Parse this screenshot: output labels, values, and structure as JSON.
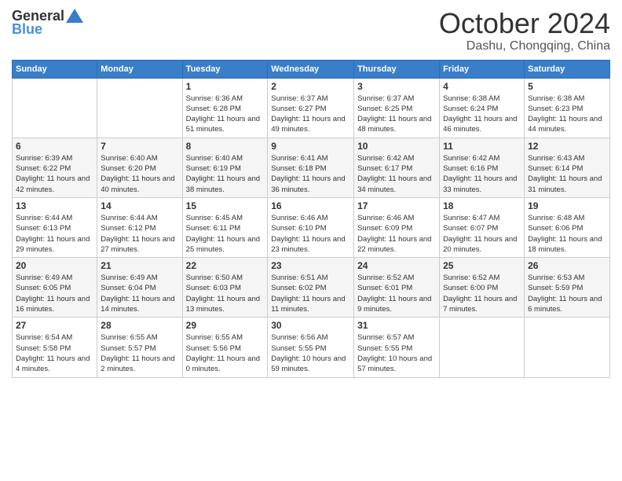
{
  "logo": {
    "general": "General",
    "blue": "Blue"
  },
  "title": "October 2024",
  "location": "Dashu, Chongqing, China",
  "headers": [
    "Sunday",
    "Monday",
    "Tuesday",
    "Wednesday",
    "Thursday",
    "Friday",
    "Saturday"
  ],
  "weeks": [
    [
      {
        "day": "",
        "sunrise": "",
        "sunset": "",
        "daylight": ""
      },
      {
        "day": "",
        "sunrise": "",
        "sunset": "",
        "daylight": ""
      },
      {
        "day": "1",
        "sunrise": "Sunrise: 6:36 AM",
        "sunset": "Sunset: 6:28 PM",
        "daylight": "Daylight: 11 hours and 51 minutes."
      },
      {
        "day": "2",
        "sunrise": "Sunrise: 6:37 AM",
        "sunset": "Sunset: 6:27 PM",
        "daylight": "Daylight: 11 hours and 49 minutes."
      },
      {
        "day": "3",
        "sunrise": "Sunrise: 6:37 AM",
        "sunset": "Sunset: 6:25 PM",
        "daylight": "Daylight: 11 hours and 48 minutes."
      },
      {
        "day": "4",
        "sunrise": "Sunrise: 6:38 AM",
        "sunset": "Sunset: 6:24 PM",
        "daylight": "Daylight: 11 hours and 46 minutes."
      },
      {
        "day": "5",
        "sunrise": "Sunrise: 6:38 AM",
        "sunset": "Sunset: 6:23 PM",
        "daylight": "Daylight: 11 hours and 44 minutes."
      }
    ],
    [
      {
        "day": "6",
        "sunrise": "Sunrise: 6:39 AM",
        "sunset": "Sunset: 6:22 PM",
        "daylight": "Daylight: 11 hours and 42 minutes."
      },
      {
        "day": "7",
        "sunrise": "Sunrise: 6:40 AM",
        "sunset": "Sunset: 6:20 PM",
        "daylight": "Daylight: 11 hours and 40 minutes."
      },
      {
        "day": "8",
        "sunrise": "Sunrise: 6:40 AM",
        "sunset": "Sunset: 6:19 PM",
        "daylight": "Daylight: 11 hours and 38 minutes."
      },
      {
        "day": "9",
        "sunrise": "Sunrise: 6:41 AM",
        "sunset": "Sunset: 6:18 PM",
        "daylight": "Daylight: 11 hours and 36 minutes."
      },
      {
        "day": "10",
        "sunrise": "Sunrise: 6:42 AM",
        "sunset": "Sunset: 6:17 PM",
        "daylight": "Daylight: 11 hours and 34 minutes."
      },
      {
        "day": "11",
        "sunrise": "Sunrise: 6:42 AM",
        "sunset": "Sunset: 6:16 PM",
        "daylight": "Daylight: 11 hours and 33 minutes."
      },
      {
        "day": "12",
        "sunrise": "Sunrise: 6:43 AM",
        "sunset": "Sunset: 6:14 PM",
        "daylight": "Daylight: 11 hours and 31 minutes."
      }
    ],
    [
      {
        "day": "13",
        "sunrise": "Sunrise: 6:44 AM",
        "sunset": "Sunset: 6:13 PM",
        "daylight": "Daylight: 11 hours and 29 minutes."
      },
      {
        "day": "14",
        "sunrise": "Sunrise: 6:44 AM",
        "sunset": "Sunset: 6:12 PM",
        "daylight": "Daylight: 11 hours and 27 minutes."
      },
      {
        "day": "15",
        "sunrise": "Sunrise: 6:45 AM",
        "sunset": "Sunset: 6:11 PM",
        "daylight": "Daylight: 11 hours and 25 minutes."
      },
      {
        "day": "16",
        "sunrise": "Sunrise: 6:46 AM",
        "sunset": "Sunset: 6:10 PM",
        "daylight": "Daylight: 11 hours and 23 minutes."
      },
      {
        "day": "17",
        "sunrise": "Sunrise: 6:46 AM",
        "sunset": "Sunset: 6:09 PM",
        "daylight": "Daylight: 11 hours and 22 minutes."
      },
      {
        "day": "18",
        "sunrise": "Sunrise: 6:47 AM",
        "sunset": "Sunset: 6:07 PM",
        "daylight": "Daylight: 11 hours and 20 minutes."
      },
      {
        "day": "19",
        "sunrise": "Sunrise: 6:48 AM",
        "sunset": "Sunset: 6:06 PM",
        "daylight": "Daylight: 11 hours and 18 minutes."
      }
    ],
    [
      {
        "day": "20",
        "sunrise": "Sunrise: 6:49 AM",
        "sunset": "Sunset: 6:05 PM",
        "daylight": "Daylight: 11 hours and 16 minutes."
      },
      {
        "day": "21",
        "sunrise": "Sunrise: 6:49 AM",
        "sunset": "Sunset: 6:04 PM",
        "daylight": "Daylight: 11 hours and 14 minutes."
      },
      {
        "day": "22",
        "sunrise": "Sunrise: 6:50 AM",
        "sunset": "Sunset: 6:03 PM",
        "daylight": "Daylight: 11 hours and 13 minutes."
      },
      {
        "day": "23",
        "sunrise": "Sunrise: 6:51 AM",
        "sunset": "Sunset: 6:02 PM",
        "daylight": "Daylight: 11 hours and 11 minutes."
      },
      {
        "day": "24",
        "sunrise": "Sunrise: 6:52 AM",
        "sunset": "Sunset: 6:01 PM",
        "daylight": "Daylight: 11 hours and 9 minutes."
      },
      {
        "day": "25",
        "sunrise": "Sunrise: 6:52 AM",
        "sunset": "Sunset: 6:00 PM",
        "daylight": "Daylight: 11 hours and 7 minutes."
      },
      {
        "day": "26",
        "sunrise": "Sunrise: 6:53 AM",
        "sunset": "Sunset: 5:59 PM",
        "daylight": "Daylight: 11 hours and 6 minutes."
      }
    ],
    [
      {
        "day": "27",
        "sunrise": "Sunrise: 6:54 AM",
        "sunset": "Sunset: 5:58 PM",
        "daylight": "Daylight: 11 hours and 4 minutes."
      },
      {
        "day": "28",
        "sunrise": "Sunrise: 6:55 AM",
        "sunset": "Sunset: 5:57 PM",
        "daylight": "Daylight: 11 hours and 2 minutes."
      },
      {
        "day": "29",
        "sunrise": "Sunrise: 6:55 AM",
        "sunset": "Sunset: 5:56 PM",
        "daylight": "Daylight: 11 hours and 0 minutes."
      },
      {
        "day": "30",
        "sunrise": "Sunrise: 6:56 AM",
        "sunset": "Sunset: 5:55 PM",
        "daylight": "Daylight: 10 hours and 59 minutes."
      },
      {
        "day": "31",
        "sunrise": "Sunrise: 6:57 AM",
        "sunset": "Sunset: 5:55 PM",
        "daylight": "Daylight: 10 hours and 57 minutes."
      },
      {
        "day": "",
        "sunrise": "",
        "sunset": "",
        "daylight": ""
      },
      {
        "day": "",
        "sunrise": "",
        "sunset": "",
        "daylight": ""
      }
    ]
  ]
}
